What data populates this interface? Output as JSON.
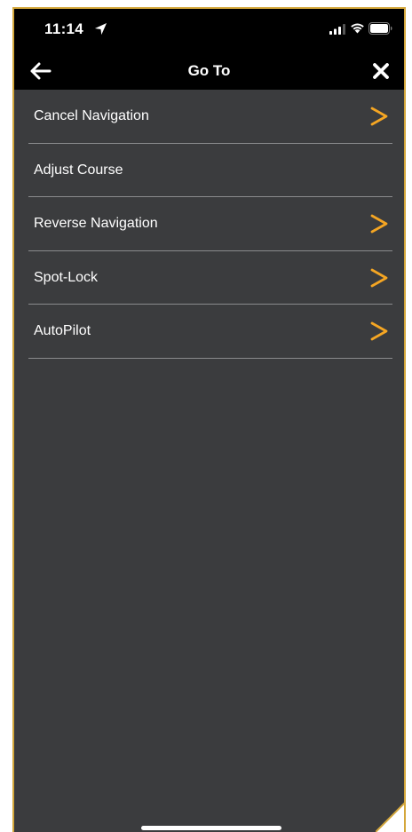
{
  "status_bar": {
    "time": "11:14"
  },
  "header": {
    "title": "Go To"
  },
  "menu": {
    "items": [
      {
        "label": "Cancel Navigation",
        "has_chevron": true
      },
      {
        "label": "Adjust Course",
        "has_chevron": false
      },
      {
        "label": "Reverse Navigation",
        "has_chevron": true
      },
      {
        "label": "Spot-Lock",
        "has_chevron": true
      },
      {
        "label": "AutoPilot",
        "has_chevron": true
      }
    ]
  },
  "colors": {
    "background": "#3b3c3e",
    "header": "#000000",
    "accent": "#f5a623",
    "frame_border": "#d4a73b",
    "divider": "#8a8b8d"
  },
  "icons": {
    "back": "arrow-left-icon",
    "close": "close-icon",
    "chevron": "chevron-right-icon",
    "location": "location-arrow-icon",
    "signal": "cellular-signal-icon",
    "wifi": "wifi-icon",
    "battery": "battery-icon"
  }
}
